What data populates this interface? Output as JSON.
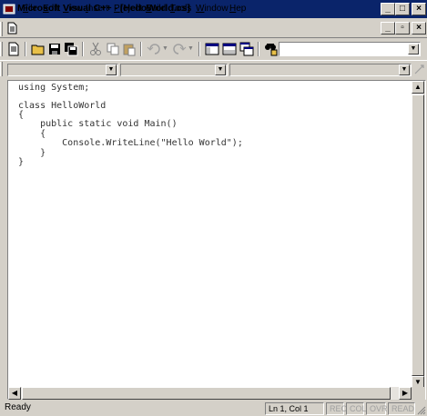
{
  "window": {
    "title": "Microsoft Visual C++ - [HelloWorld.cs]"
  },
  "menu": {
    "items": [
      {
        "label": "File",
        "key": "F",
        "rest": "ile"
      },
      {
        "label": "Edit",
        "key": "E",
        "rest": "dit"
      },
      {
        "label": "View",
        "key": "V",
        "rest": "iew"
      },
      {
        "label": "Insert",
        "key": "I",
        "rest": "nsert"
      },
      {
        "label": "Project",
        "key": "P",
        "rest": "roject"
      },
      {
        "label": "Build",
        "key": "B",
        "rest": "uild"
      },
      {
        "label": "Tools",
        "key": "T",
        "rest": "ools"
      },
      {
        "label": "Window",
        "key": "W",
        "rest": "indow"
      },
      {
        "label": "Hep",
        "key": "H",
        "rest": "ep"
      }
    ]
  },
  "icons": {
    "app": "app-icon",
    "minimize": "minimize-icon",
    "restore": "restore-icon",
    "close": "close-icon",
    "new": "new-file-icon",
    "open": "open-folder-icon",
    "save": "save-icon",
    "save_all": "save-all-icon",
    "cut": "cut-icon",
    "copy": "copy-icon",
    "paste": "paste-icon",
    "undo": "undo-icon",
    "redo": "redo-icon",
    "workspace": "workspace-icon",
    "output": "output-icon",
    "window_list": "window-list-icon",
    "find": "find-in-files-icon"
  },
  "editor": {
    "lines": [
      "using System;",
      "",
      "class HelloWorld",
      "{",
      "    public static void Main()",
      "    {",
      "        Console.WriteLine(\"Hello World\");",
      "    }",
      "}"
    ]
  },
  "status": {
    "text": "Ready",
    "position": "Ln 1, Col 1",
    "rec": "REC",
    "col": "COL",
    "ovr": "OVR",
    "read": "READ"
  },
  "colors": {
    "title_bar": "#0a246a",
    "face": "#d4d0c8"
  }
}
